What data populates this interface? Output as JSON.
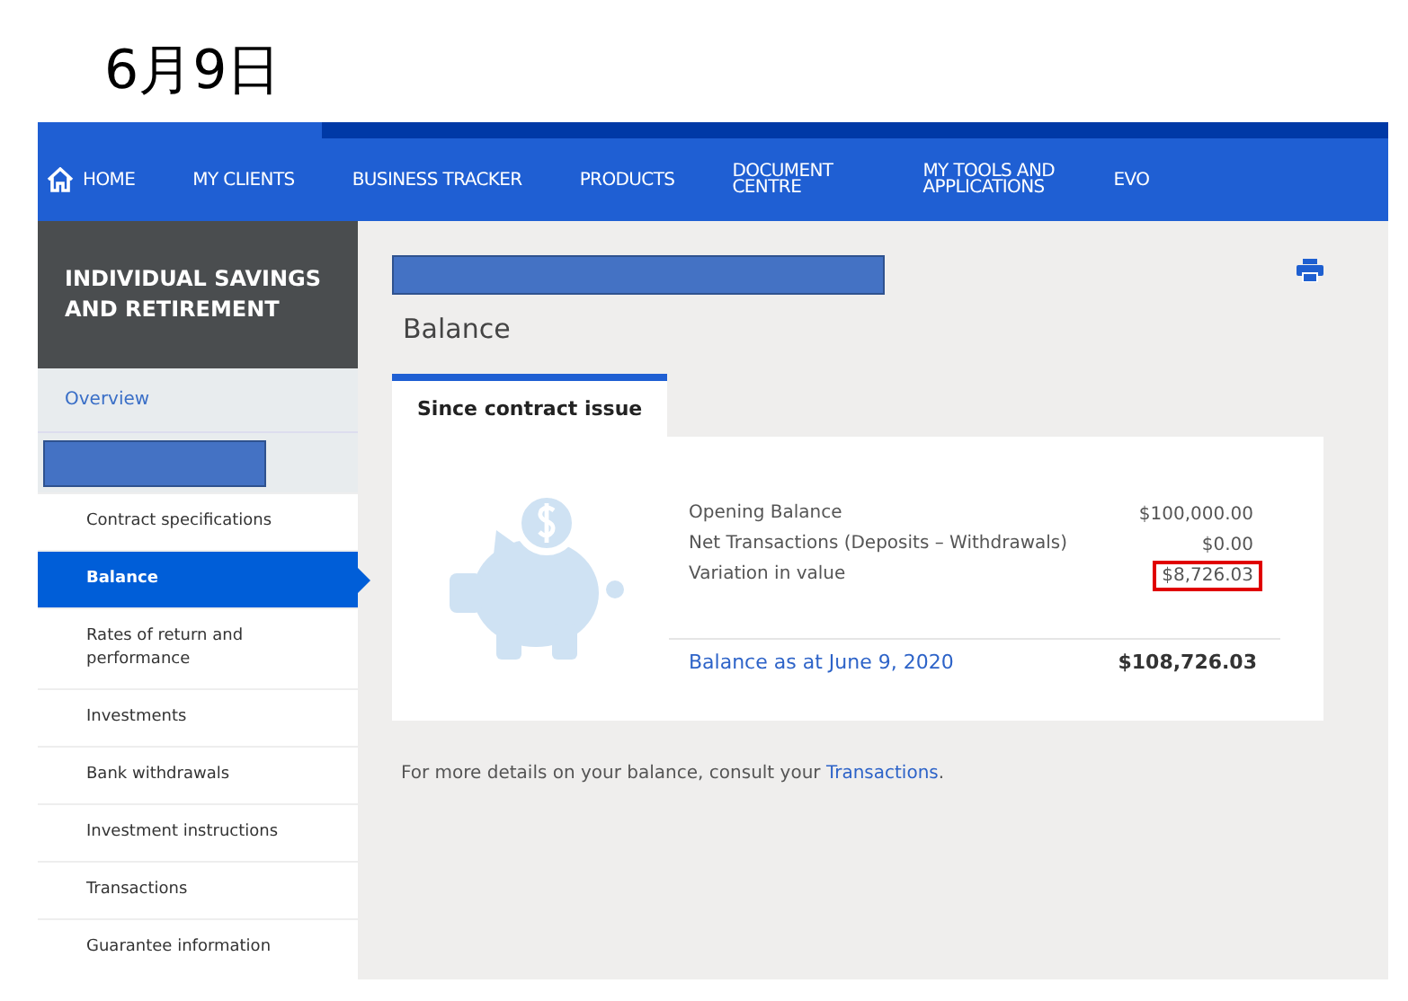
{
  "page_title": "6月9日",
  "nav": {
    "items": [
      {
        "label": "HOME",
        "kind": "home"
      },
      {
        "label": "MY CLIENTS",
        "kind": "text"
      },
      {
        "label": "BUSINESS TRACKER",
        "kind": "text"
      },
      {
        "label": "PRODUCTS",
        "kind": "text"
      },
      {
        "label": "DOCUMENT CENTRE",
        "kind": "text"
      },
      {
        "label": "MY TOOLS AND APPLICATIONS",
        "kind": "text"
      },
      {
        "label": "EVO",
        "kind": "text"
      }
    ]
  },
  "sidebar": {
    "title": "INDIVIDUAL SAVINGS AND RETIREMENT",
    "overview": "Overview",
    "items": [
      {
        "label": "Contract specifications",
        "selected": false
      },
      {
        "label": "Balance",
        "selected": true
      },
      {
        "label": "Rates of return and performance",
        "selected": false
      },
      {
        "label": "Investments",
        "selected": false
      },
      {
        "label": "Bank withdrawals",
        "selected": false
      },
      {
        "label": "Investment instructions",
        "selected": false
      },
      {
        "label": "Transactions",
        "selected": false
      },
      {
        "label": "Guarantee information",
        "selected": false
      }
    ]
  },
  "content": {
    "heading": "Balance",
    "tabs": [
      {
        "label": "Since contract issue",
        "selected": true
      }
    ],
    "rows": [
      {
        "label": "Opening Balance",
        "value": "$100,000.00",
        "highlighted": false
      },
      {
        "label": "Net Transactions (Deposits – Withdrawals)",
        "value": "$0.00",
        "highlighted": false
      },
      {
        "label": "Variation in value",
        "value": "$8,726.03",
        "highlighted": true
      }
    ],
    "total": {
      "label": "Balance as at June 9, 2020",
      "value": "$108,726.03"
    },
    "footer": {
      "text": "For more details on your balance, consult your ",
      "link": "Transactions",
      "end": "."
    }
  }
}
